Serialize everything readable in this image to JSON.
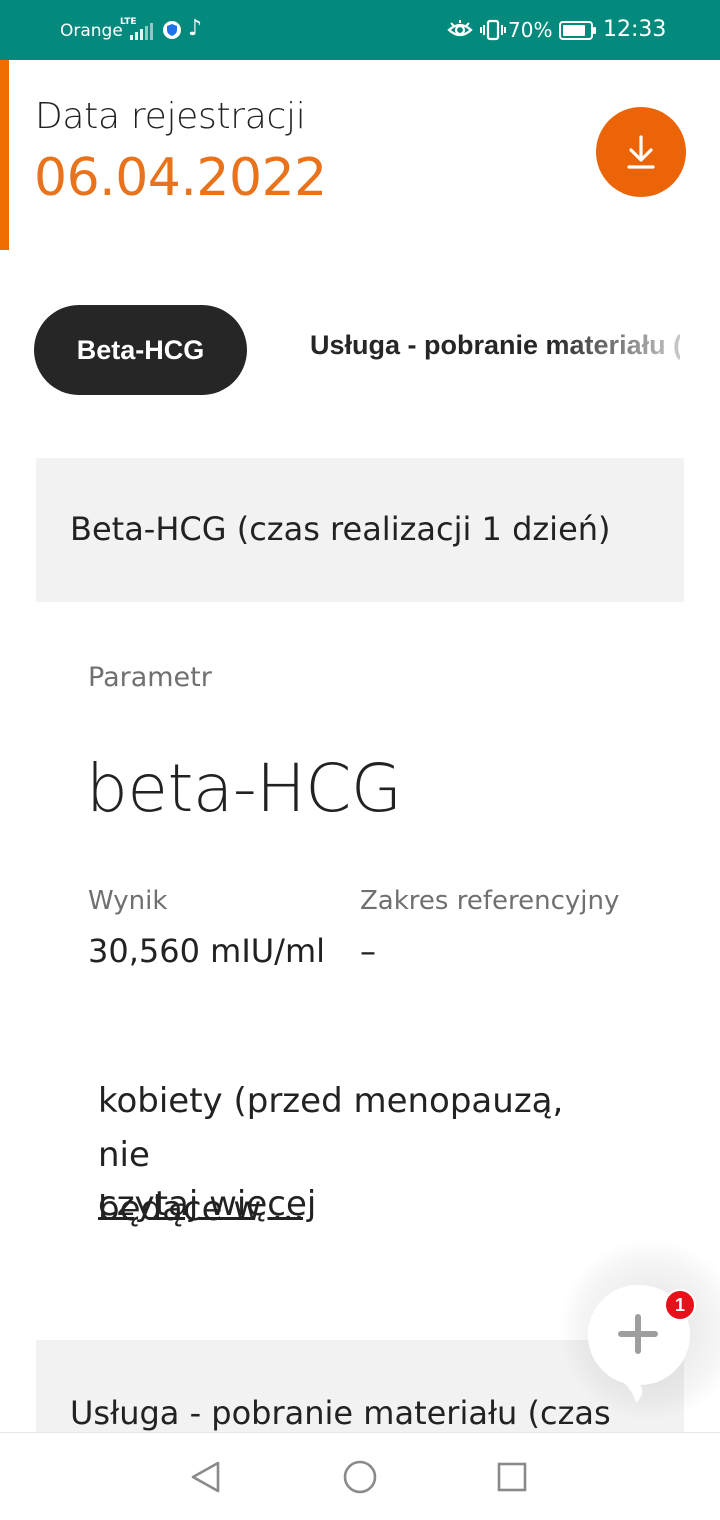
{
  "status_bar": {
    "carrier": "Orange",
    "network": "LTE",
    "battery_percent": "70%",
    "time": "12:33",
    "icons": [
      "signal-icon",
      "shield-icon",
      "tiktok-icon",
      "eye-icon",
      "vibrate-icon",
      "battery-icon"
    ]
  },
  "header": {
    "label": "Data rejestracji",
    "date": "06.04.2022",
    "download_icon": "download-icon"
  },
  "tabs": [
    {
      "label": "Beta-HCG",
      "active": true
    },
    {
      "label": "Usługa - pobranie materiału (czas",
      "active": false
    }
  ],
  "section": {
    "title": "Beta-HCG (czas realizacji 1 dzień)",
    "parameter_label": "Parametr",
    "parameter_name": "beta-HCG",
    "result_label": "Wynik",
    "result_value": "30,560 mIU/ml",
    "reference_label": "Zakres referencyjny",
    "reference_value": "–",
    "description_line1": "kobiety (przed menopauzą, nie",
    "description_line2": "będące w ...",
    "read_more": "czytaj więcej"
  },
  "section2": {
    "title": "Usługa - pobranie materiału (czas"
  },
  "fab": {
    "icon": "plus-icon",
    "badge": "1"
  },
  "nav": {
    "icons": [
      "back-icon",
      "home-icon",
      "recents-icon"
    ]
  },
  "colors": {
    "status_bar": "#048a7d",
    "accent": "#ec6408",
    "date": "#e8731c",
    "tab_active_bg": "#262626",
    "card_bg": "#f2f2f2",
    "badge": "#e8101a"
  }
}
